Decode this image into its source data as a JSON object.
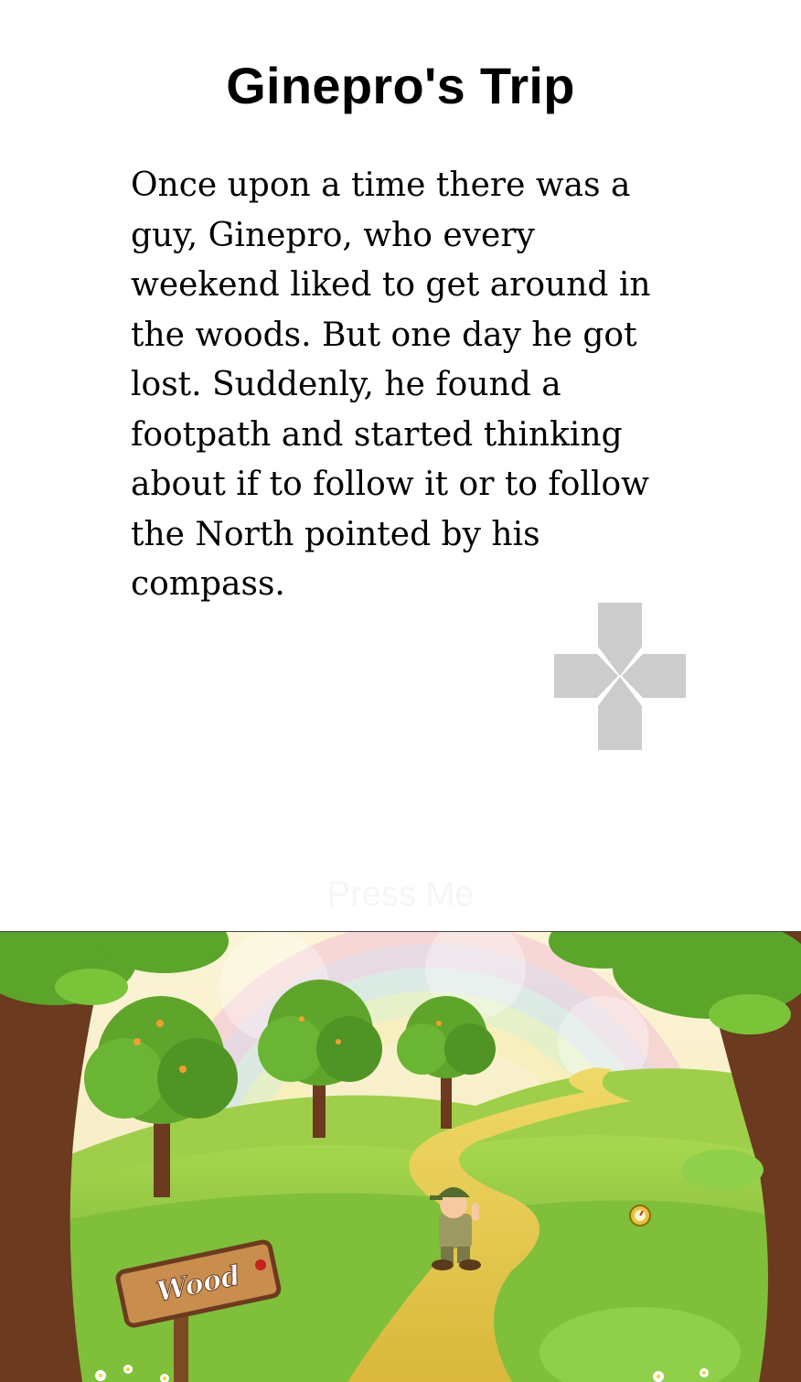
{
  "title": "Ginepro's Trip",
  "story": "Once upon a time there was a guy, Ginepro, who every weekend liked to get around in the woods. But one day he got lost. Suddenly, he found a footpath and started thinking about if to follow it or to follow the North pointed by his compass.",
  "dpad_icon": "directional-pad-icon",
  "press_button_label": "Press Me",
  "scene": {
    "sign_text": "Wood",
    "colors": {
      "sky_light": "#f7efc9",
      "grass": "#8cc63f",
      "grass_dark": "#5f9a2a",
      "path": "#e3c84a",
      "trunk": "#6b3a1f",
      "leaves": "#5fa52c",
      "sign_wood": "#c98d4e"
    }
  }
}
